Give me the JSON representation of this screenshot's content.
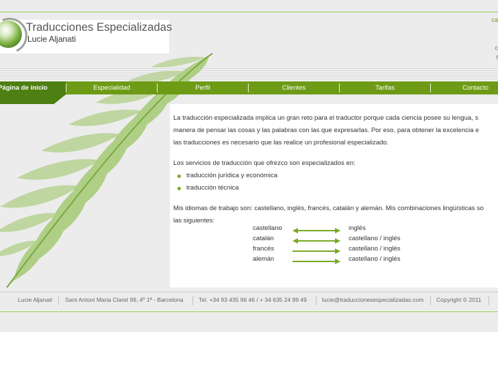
{
  "header": {
    "logo_title": "Traducciones Especializadas",
    "logo_name": "Lucie Aljanati",
    "corner_1": "ca",
    "corner_2": "c",
    "corner_3": "f"
  },
  "nav": {
    "items": [
      {
        "label": "Página de inicio"
      },
      {
        "label": "Especialidad"
      },
      {
        "label": "Perfil"
      },
      {
        "label": "Clientes"
      },
      {
        "label": "Tarifas"
      },
      {
        "label": "Contacto"
      }
    ]
  },
  "content": {
    "intro_line1": "La traducción especializada implica un gran reto para el traductor porque cada ciencia posee su lengua, s",
    "intro_line2": "manera de pensar las cosas y las palabras con las que expresarlas. Por eso, para obtener la excelencia e",
    "intro_line3": "las traducciones es necesario que las realice un profesional especializado.",
    "services_intro": "Los servicios de traducción que ofrezco son especializados en:",
    "services": [
      "traducción jurídica y económica",
      "traducción técnica"
    ],
    "languages_line1": "Mis idiomas de trabajo son: castellano, inglés, francés, catalán y alemán. Mis combinaciones lingüísticas so",
    "languages_line2": "las siguientes:",
    "pairs": [
      {
        "source": "castellano",
        "target": "inglés",
        "bidirectional": true
      },
      {
        "source": "catalán",
        "target": "castellano / inglés",
        "bidirectional": true
      },
      {
        "source": "francés",
        "target": "castellano / inglés",
        "bidirectional": false
      },
      {
        "source": "alemán",
        "target": "castellano / inglés",
        "bidirectional": false
      }
    ]
  },
  "footer": {
    "name": "Lucie Aljanati",
    "address": "Sant Antoni Maria Claret 99, 4º 1ª - Barcelona",
    "phone": "Tel. +34 93 435 96 46 / + 34 635 24 99 49",
    "email": "lucie@traduccionesespecializadas.com",
    "copyright": "Copyright © 2011"
  },
  "colors": {
    "nav_green": "#6d9b16",
    "nav_active": "#4d7f12",
    "accent_green": "#79a824",
    "leaf_green": "#a9cc7c"
  }
}
